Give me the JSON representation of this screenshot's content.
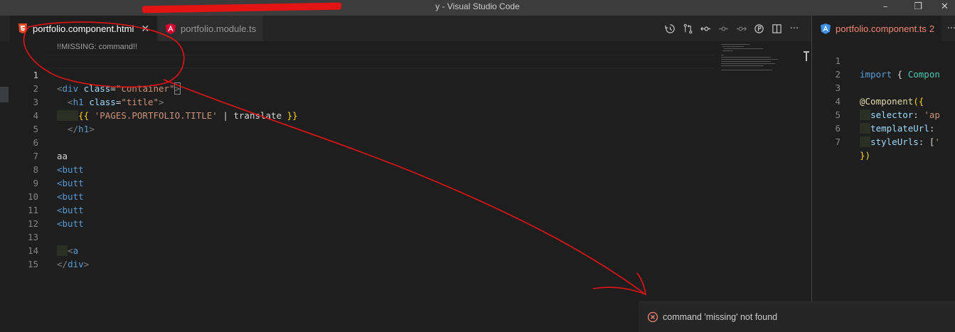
{
  "window": {
    "title": "y - Visual Studio Code",
    "minimize": "–",
    "maximize": "❐",
    "close": "✕"
  },
  "left_group": {
    "tabs": [
      {
        "label": "portfolio.component.html",
        "icon": "html5-icon",
        "active": true,
        "close": "✕"
      },
      {
        "label": "portfolio.module.ts",
        "icon": "angular-icon",
        "active": false
      }
    ],
    "actions": [
      "timeline-icon",
      "git-compare-icon",
      "go-to-previous-change-icon",
      "go-to-change-icon",
      "go-to-next-change-icon",
      "open-changes-icon",
      "split-editor-icon",
      "more-actions-icon"
    ],
    "more_label": "···",
    "breadcrumb": "!!MISSING: command!!",
    "line_numbers": [
      "1",
      "2",
      "3",
      "4",
      "5",
      "6",
      "7",
      "8",
      "9",
      "10",
      "11",
      "12",
      "13",
      "14",
      "15"
    ],
    "code": {
      "l1": {
        "lt": "<",
        "tag": "div",
        "attr": "class",
        "eq": "=",
        "val": "\"container\"",
        "gt": ">"
      },
      "l2": {
        "lt": "<",
        "tag": "h1",
        "attr": "class",
        "eq": "=",
        "val": "\"title\"",
        "gt": ">"
      },
      "l3": {
        "open": "{{",
        "str": "'PAGES.PORTFOLIO.TITLE'",
        "pipe": " | translate ",
        "close": "}}"
      },
      "l4": {
        "lt": "</",
        "tag": "h1",
        "gt": ">"
      },
      "l6": "aa",
      "butt": "<butt",
      "l13": {
        "lt": "<",
        "tag": "a"
      },
      "l14": {
        "lt": "</",
        "tag": "div",
        "gt": ">"
      }
    }
  },
  "right_group": {
    "tab": {
      "label": "portfolio.component.ts",
      "errors": "2",
      "icon": "angular-icon"
    },
    "more_label": "···",
    "line_numbers": [
      "1",
      "2",
      "3",
      "4",
      "5",
      "6",
      "7"
    ],
    "code": {
      "l1": {
        "kw": "import",
        "punc": " { ",
        "cls": "Compon"
      },
      "l3": {
        "dec": "@Component",
        "punc": "({"
      },
      "l4": {
        "prop": "selector",
        "punc": ": ",
        "str": "'ap"
      },
      "l5": {
        "prop": "templateUrl",
        "punc": ":"
      },
      "l6": {
        "prop": "styleUrls",
        "punc": ": [",
        "str": "'"
      },
      "l7": "})"
    }
  },
  "notification": {
    "message": "command 'missing' not found",
    "icon": "error-icon"
  },
  "colors": {
    "annotation": "#e51414",
    "error": "#f48771"
  }
}
